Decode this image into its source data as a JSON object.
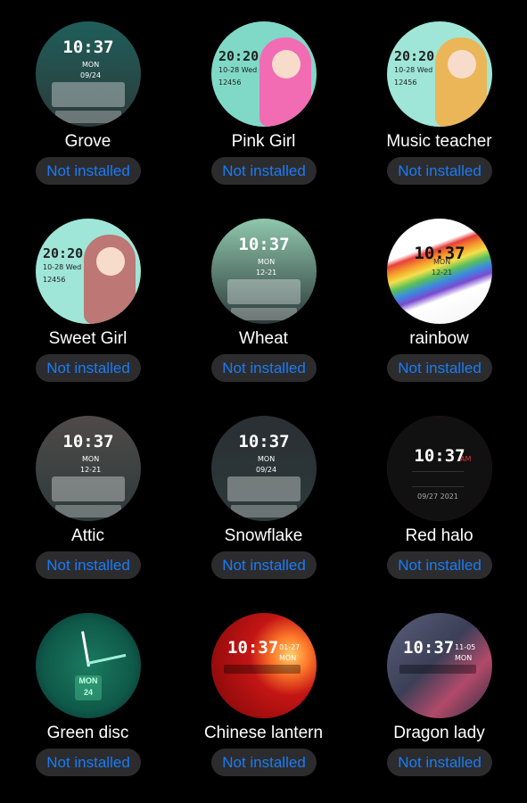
{
  "faces": [
    {
      "name": "Grove",
      "status": "Not installed",
      "time": "10:37",
      "sub": "MON",
      "date": "09/24",
      "bg": "#1f5e5a",
      "accent": "#7fd1c7",
      "style": "panel"
    },
    {
      "name": "Pink Girl",
      "status": "Not installed",
      "time": "20:20",
      "sub": "10-28 Wed",
      "date": "12456",
      "bg": "#7fd9c6",
      "accent": "#ff5fb1",
      "style": "girl"
    },
    {
      "name": "Music teacher",
      "status": "Not installed",
      "time": "20:20",
      "sub": "10-28 Wed",
      "date": "12456",
      "bg": "#9fe6d8",
      "accent": "#f2b04a",
      "style": "girl"
    },
    {
      "name": "Sweet Girl",
      "status": "Not installed",
      "time": "20:20",
      "sub": "10-28 Wed",
      "date": "12456",
      "bg": "#9fe6d8",
      "accent": "#c06a6a",
      "style": "girl"
    },
    {
      "name": "Wheat",
      "status": "Not installed",
      "time": "10:37",
      "sub": "MON",
      "date": "12-21",
      "bg": "#8fc7ad",
      "accent": "#dff3e6",
      "style": "panel"
    },
    {
      "name": "rainbow",
      "status": "Not installed",
      "time": "10:37",
      "sub": "MON",
      "date": "12-21",
      "bg": "#f2f2f2",
      "accent": "#e8403a",
      "style": "rainbow"
    },
    {
      "name": "Attic",
      "status": "Not installed",
      "time": "10:37",
      "sub": "MON",
      "date": "12-21",
      "bg": "#4f4a49",
      "accent": "#d1a98a",
      "style": "panel"
    },
    {
      "name": "Snowflake",
      "status": "Not installed",
      "time": "10:37",
      "sub": "MON",
      "date": "09/24",
      "bg": "#2a2f33",
      "accent": "#bfc7cf",
      "style": "panel"
    },
    {
      "name": "Red halo",
      "status": "Not installed",
      "time": "10:37",
      "sub": "AM",
      "date": "09/27  2021",
      "bg": "#121212",
      "accent": "#e03434",
      "style": "halo"
    },
    {
      "name": "Green disc",
      "status": "Not installed",
      "time": "MON",
      "sub": "24",
      "date": "",
      "bg": "#0b4f46",
      "accent": "#3fc28a",
      "style": "analog"
    },
    {
      "name": "Chinese lantern",
      "status": "Not installed",
      "time": "10:37",
      "sub": "01-27",
      "date": "MON",
      "bg": "#b51010",
      "accent": "#ffd37a",
      "style": "lantern"
    },
    {
      "name": "Dragon lady",
      "status": "Not installed",
      "time": "10:37",
      "sub": "11-05",
      "date": "MON",
      "bg": "#3b3f57",
      "accent": "#ffb3c8",
      "style": "dragon"
    }
  ]
}
